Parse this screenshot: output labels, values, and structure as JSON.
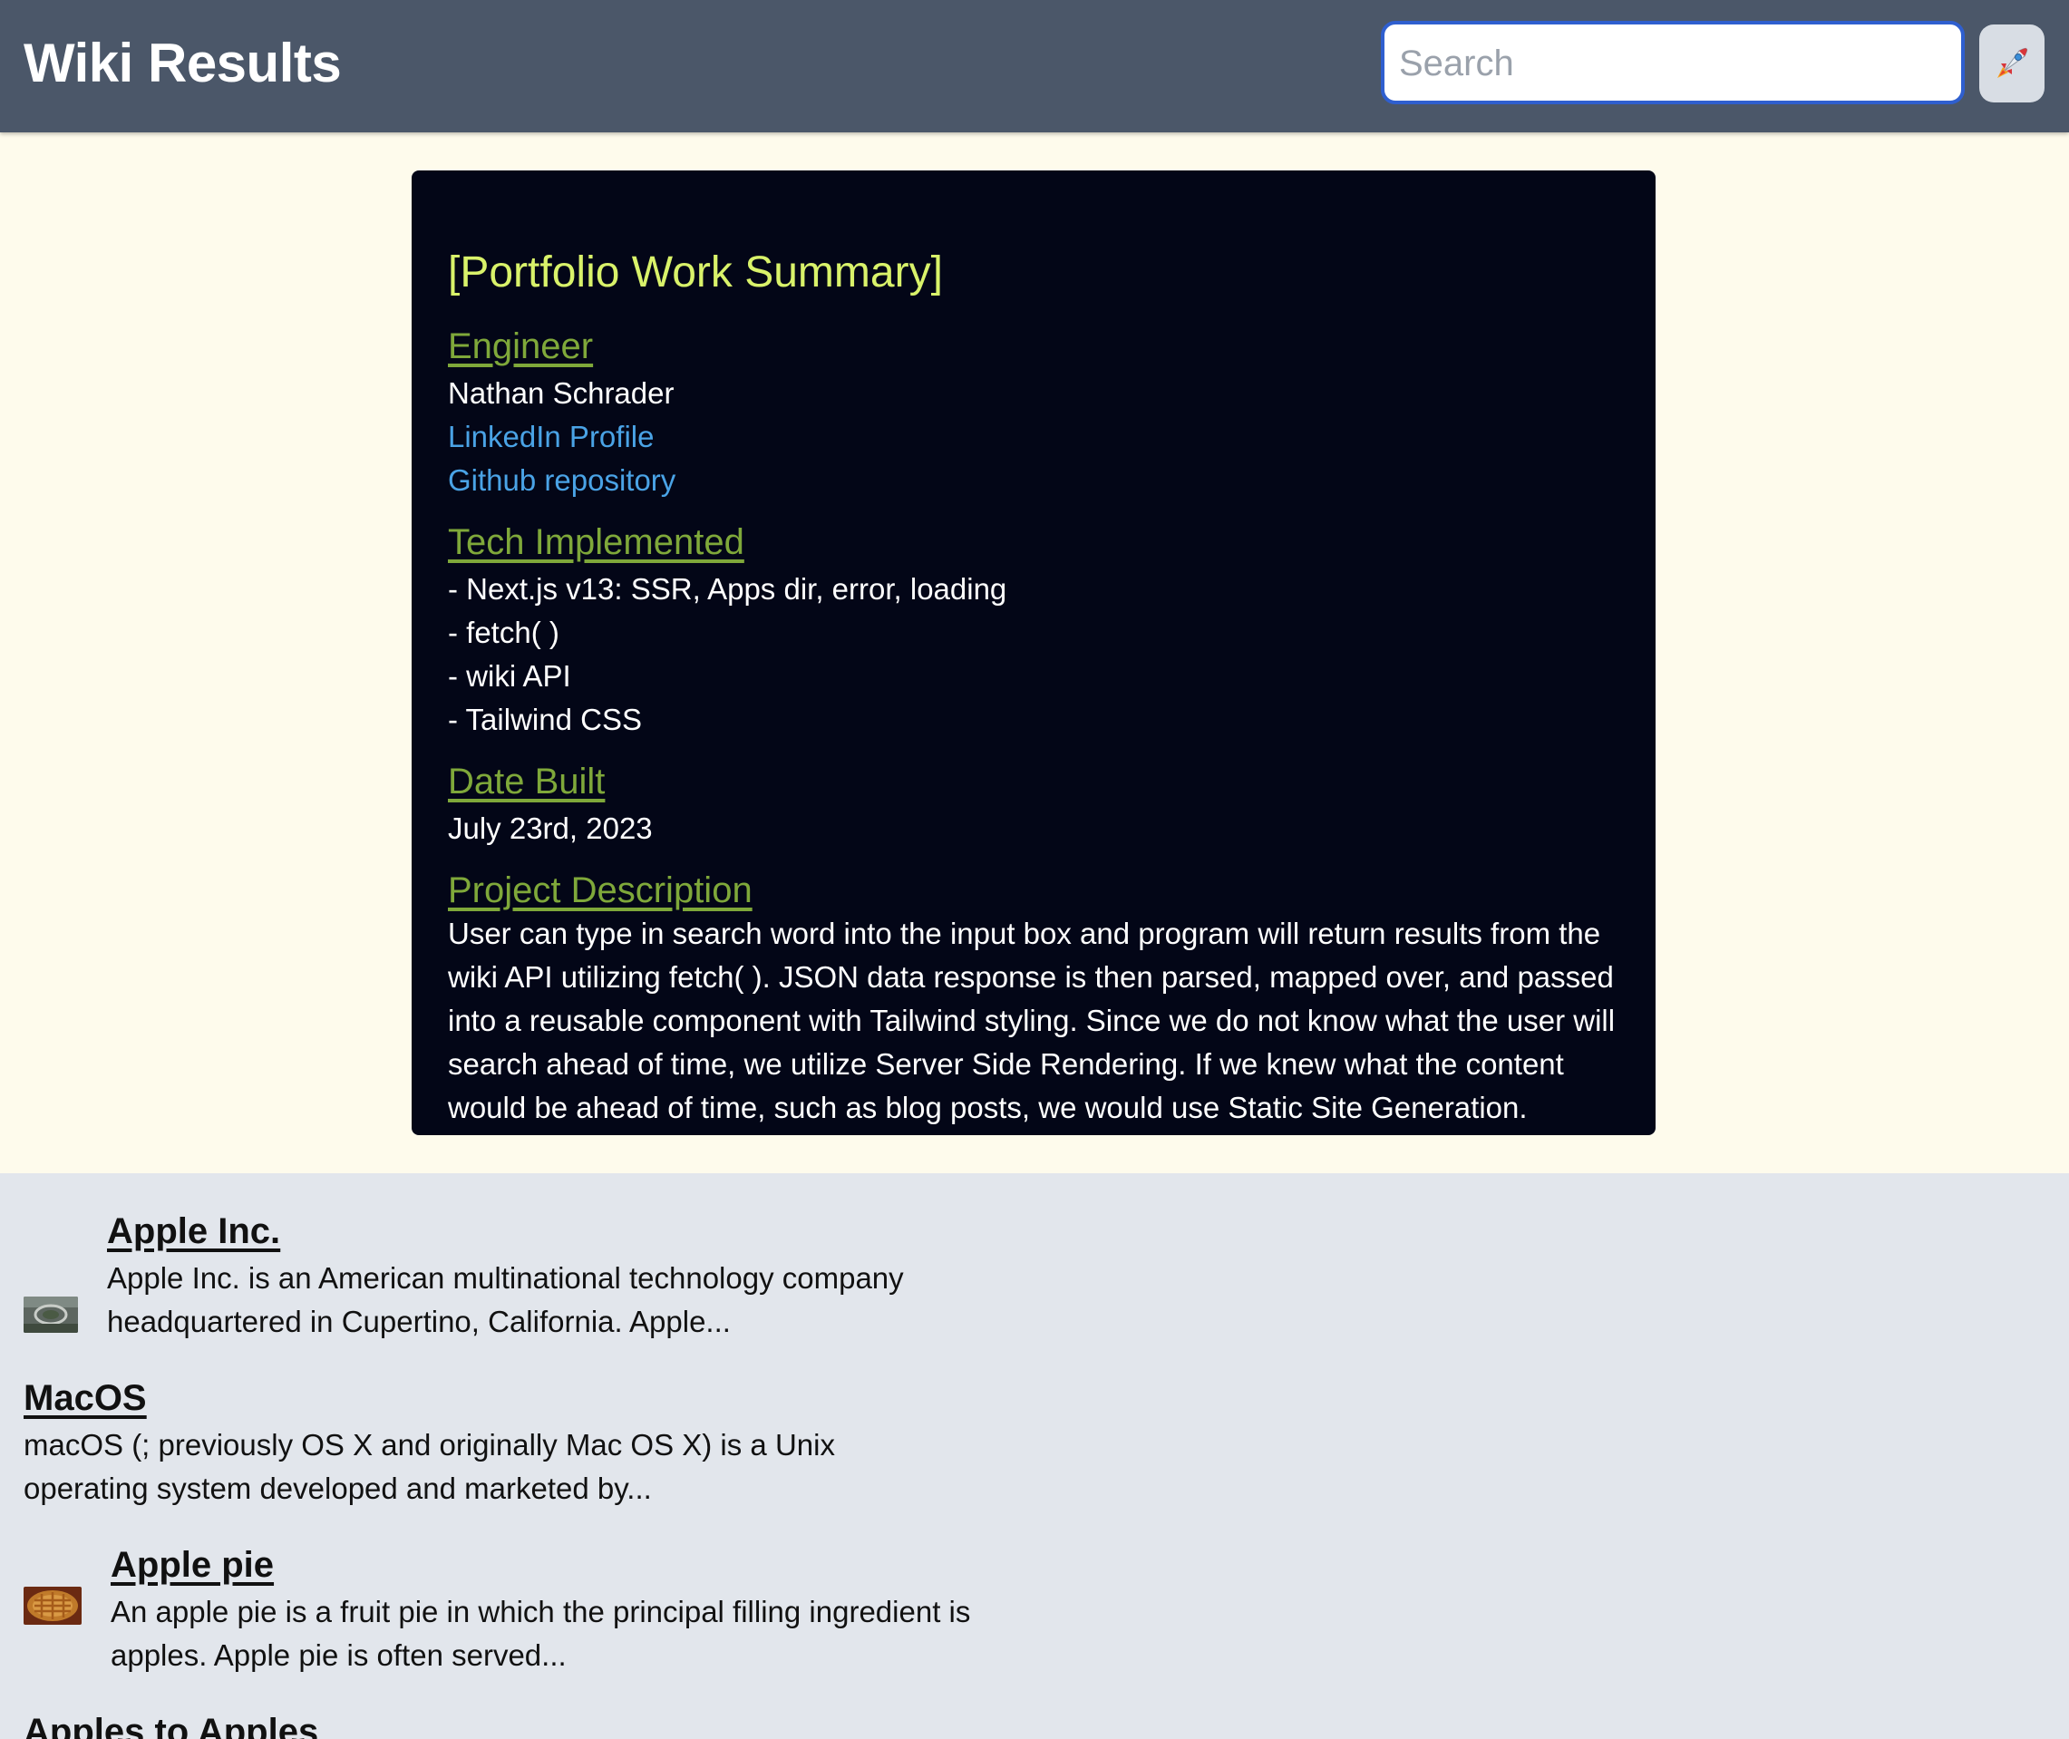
{
  "header": {
    "title": "Wiki Results",
    "search_placeholder": "Search",
    "search_value": "",
    "go_button_icon": "rocket-icon"
  },
  "summary": {
    "heading": "[Portfolio Work Summary]",
    "engineer_title": "Engineer",
    "engineer_name": "Nathan Schrader",
    "linkedin_label": "LinkedIn Profile",
    "github_label": "Github repository",
    "tech_title": "Tech Implemented",
    "tech_items": [
      "- Next.js v13: SSR, Apps dir, error, loading",
      "- fetch( )",
      "- wiki API",
      "- Tailwind CSS"
    ],
    "date_title": "Date Built",
    "date_value": "July 23rd, 2023",
    "description_title": "Project Description",
    "description": "User can type in search word into the input box and program will return results from the wiki API utilizing fetch( ). JSON data response is then parsed, mapped over, and passed into a reusable component with Tailwind styling. Since we do not know what the user will search ahead of time, we utilize Server Side Rendering. If we knew what the content would be ahead of time, such as blog posts, we would use Static Site Generation."
  },
  "results": [
    {
      "title": "Apple Inc.",
      "extract": "Apple Inc. is an American multinational technology company headquartered in Cupertino, California. Apple...",
      "has_thumbnail": true,
      "thumbnail": "apple-park-aerial-thumbnail"
    },
    {
      "title": "MacOS",
      "extract": "macOS (; previously OS X and originally Mac OS X) is a Unix operating system developed and marketed by...",
      "has_thumbnail": false
    },
    {
      "title": "Apple pie",
      "extract": "An apple pie is a fruit pie in which the principal filling ingredient is apples. Apple pie is often served...",
      "has_thumbnail": true,
      "thumbnail": "apple-pie-thumbnail"
    },
    {
      "title": "Apples to Apples",
      "extract": "",
      "has_thumbnail": false
    }
  ],
  "colors": {
    "header_bg": "#4b5769",
    "summary_bg": "#fefbec",
    "card_bg": "#030617",
    "heading_yellow": "#d9f26a",
    "section_green": "#7fa83a",
    "link_blue": "#4aa3e6",
    "results_bg": "#e2e6ec"
  }
}
